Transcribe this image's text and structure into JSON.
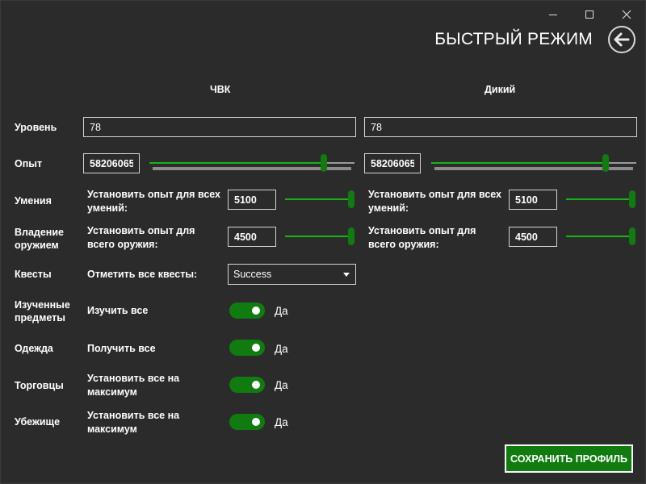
{
  "window": {
    "title": "БЫСТРЫЙ РЕЖИМ"
  },
  "icons": {
    "minimize": "minimize-icon",
    "maximize": "maximize-icon",
    "close": "close-icon",
    "back": "arrow-left-icon",
    "dropdown": "chevron-down-icon"
  },
  "colors": {
    "background": "#2b2b2b",
    "accent": "#107c10",
    "slider_fill": "#17b217",
    "border": "#d4d4d4"
  },
  "columns": {
    "pmc": "ЧВК",
    "scav": "Дикий"
  },
  "rows": {
    "level": "Уровень",
    "experience": "Опыт",
    "skills": "Умения",
    "weapon_mastery": "Владение оружием",
    "quests": "Квесты",
    "examined_items": "Изученные предметы",
    "clothing": "Одежда",
    "traders": "Торговцы",
    "hideout": "Убежище"
  },
  "pmc": {
    "level": "78",
    "experience": "58206065",
    "experience_slider": 0.86,
    "skills_label": "Установить опыт для всех умений:",
    "skills_value": "5100",
    "skills_slider": 1.0,
    "mastery_label": "Установить опыт для всего оружия:",
    "mastery_value": "4500",
    "mastery_slider": 1.0
  },
  "scav": {
    "level": "78",
    "experience": "58206065",
    "experience_slider": 0.86,
    "skills_label": "Установить опыт для всех умений:",
    "skills_value": "5100",
    "skills_slider": 1.0,
    "mastery_label": "Установить опыт для всего оружия:",
    "mastery_value": "4500",
    "mastery_slider": 1.0
  },
  "quests": {
    "label": "Отметить все квесты:",
    "selected": "Success"
  },
  "examined": {
    "label": "Изучить все",
    "state": "Да",
    "on": true
  },
  "clothing": {
    "label": "Получить все",
    "state": "Да",
    "on": true
  },
  "traders": {
    "label": "Установить все на максимум",
    "state": "Да",
    "on": true
  },
  "hideout": {
    "label": "Установить все на максимум",
    "state": "Да",
    "on": true
  },
  "save_button": "СОХРАНИТЬ ПРОФИЛЬ"
}
